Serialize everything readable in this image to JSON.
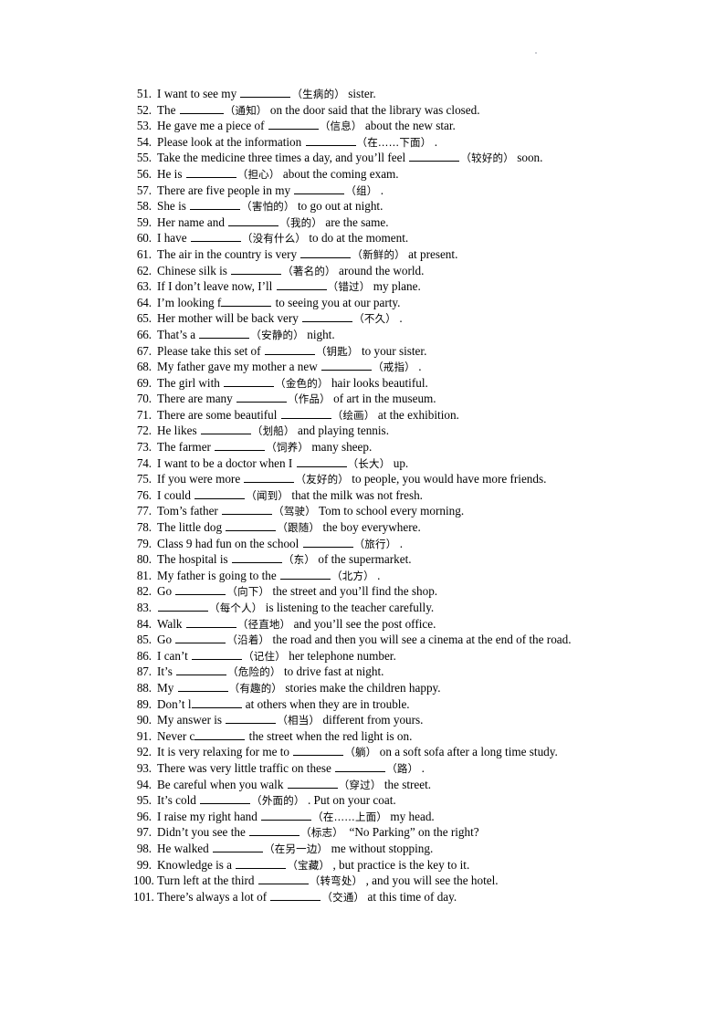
{
  "document": {
    "type": "worksheet",
    "title": "English vocabulary fill-in-the-blank exercises 51-101",
    "page_background": "#ffffff",
    "text_color": "#000000"
  },
  "exercises": [
    {
      "number": "51.",
      "segments": [
        {
          "kind": "text",
          "value": "I want to see my "
        },
        {
          "kind": "blank"
        },
        {
          "kind": "cn",
          "value": "（生病的）"
        },
        {
          "kind": "text",
          "value": " sister."
        }
      ]
    },
    {
      "number": "52.",
      "segments": [
        {
          "kind": "text",
          "value": "The "
        },
        {
          "kind": "blank",
          "width": "short"
        },
        {
          "kind": "cn",
          "value": "（通知）"
        },
        {
          "kind": "text",
          "value": " on the door said that the library was closed."
        }
      ]
    },
    {
      "number": "53.",
      "segments": [
        {
          "kind": "text",
          "value": "He gave me a piece of "
        },
        {
          "kind": "blank"
        },
        {
          "kind": "cn",
          "value": "（信息）"
        },
        {
          "kind": "text",
          "value": " about the new star."
        }
      ]
    },
    {
      "number": "54.",
      "segments": [
        {
          "kind": "text",
          "value": "Please look at the information "
        },
        {
          "kind": "blank"
        },
        {
          "kind": "cn",
          "value": "（在……下面）"
        },
        {
          "kind": "text",
          "value": " ."
        }
      ]
    },
    {
      "number": "55.",
      "segments": [
        {
          "kind": "text",
          "value": "Take the medicine three times a day, and you’ll feel "
        },
        {
          "kind": "blank"
        },
        {
          "kind": "cn",
          "value": "（较好的）"
        },
        {
          "kind": "text",
          "value": " soon."
        }
      ]
    },
    {
      "number": "56.",
      "segments": [
        {
          "kind": "text",
          "value": "He is "
        },
        {
          "kind": "blank"
        },
        {
          "kind": "cn",
          "value": "（担心）"
        },
        {
          "kind": "text",
          "value": " about the coming exam."
        }
      ]
    },
    {
      "number": "57.",
      "segments": [
        {
          "kind": "text",
          "value": "There are five people in my "
        },
        {
          "kind": "blank"
        },
        {
          "kind": "cn",
          "value": "（组）"
        },
        {
          "kind": "text",
          "value": " ."
        }
      ]
    },
    {
      "number": "58.",
      "segments": [
        {
          "kind": "text",
          "value": "She is "
        },
        {
          "kind": "blank"
        },
        {
          "kind": "cn",
          "value": "（害怕的）"
        },
        {
          "kind": "text",
          "value": " to go out at night."
        }
      ]
    },
    {
      "number": "59.",
      "segments": [
        {
          "kind": "text",
          "value": "Her name and "
        },
        {
          "kind": "blank"
        },
        {
          "kind": "cn",
          "value": "（我的）"
        },
        {
          "kind": "text",
          "value": " are the same."
        }
      ]
    },
    {
      "number": "60.",
      "segments": [
        {
          "kind": "text",
          "value": "I have "
        },
        {
          "kind": "blank"
        },
        {
          "kind": "cn",
          "value": "（没有什么）"
        },
        {
          "kind": "text",
          "value": " to do at the moment."
        }
      ]
    },
    {
      "number": "61.",
      "segments": [
        {
          "kind": "text",
          "value": "The air in the country is very "
        },
        {
          "kind": "blank"
        },
        {
          "kind": "cn",
          "value": "（新鲜的）"
        },
        {
          "kind": "text",
          "value": " at present."
        }
      ]
    },
    {
      "number": "62.",
      "segments": [
        {
          "kind": "text",
          "value": "Chinese silk is "
        },
        {
          "kind": "blank"
        },
        {
          "kind": "cn",
          "value": "（著名的）"
        },
        {
          "kind": "text",
          "value": " around the world."
        }
      ]
    },
    {
      "number": "63.",
      "segments": [
        {
          "kind": "text",
          "value": "If I don’t leave now, I’ll "
        },
        {
          "kind": "blank"
        },
        {
          "kind": "cn",
          "value": "（错过）"
        },
        {
          "kind": "text",
          "value": " my plane."
        }
      ]
    },
    {
      "number": "64.",
      "segments": [
        {
          "kind": "text",
          "value": "I’m looking f"
        },
        {
          "kind": "blank",
          "fused": true
        },
        {
          "kind": "text",
          "value": " to seeing you at our party."
        }
      ]
    },
    {
      "number": "65.",
      "segments": [
        {
          "kind": "text",
          "value": "Her mother will be back very "
        },
        {
          "kind": "blank"
        },
        {
          "kind": "cn",
          "value": "（不久）"
        },
        {
          "kind": "text",
          "value": " ."
        }
      ]
    },
    {
      "number": "66.",
      "segments": [
        {
          "kind": "text",
          "value": "That’s a "
        },
        {
          "kind": "blank"
        },
        {
          "kind": "cn",
          "value": "（安静的）"
        },
        {
          "kind": "text",
          "value": " night."
        }
      ]
    },
    {
      "number": "67.",
      "segments": [
        {
          "kind": "text",
          "value": "Please take this set of "
        },
        {
          "kind": "blank"
        },
        {
          "kind": "cn",
          "value": "（钥匙）"
        },
        {
          "kind": "text",
          "value": " to your sister."
        }
      ]
    },
    {
      "number": "68.",
      "segments": [
        {
          "kind": "text",
          "value": "My father gave my mother a new "
        },
        {
          "kind": "blank"
        },
        {
          "kind": "cn",
          "value": "（戒指）"
        },
        {
          "kind": "text",
          "value": " ."
        }
      ]
    },
    {
      "number": "69.",
      "segments": [
        {
          "kind": "text",
          "value": "The girl with "
        },
        {
          "kind": "blank"
        },
        {
          "kind": "cn",
          "value": "（金色的）"
        },
        {
          "kind": "text",
          "value": " hair looks beautiful."
        }
      ]
    },
    {
      "number": "70.",
      "segments": [
        {
          "kind": "text",
          "value": "There are many "
        },
        {
          "kind": "blank"
        },
        {
          "kind": "cn",
          "value": "（作品）"
        },
        {
          "kind": "text",
          "value": " of art in the museum."
        }
      ]
    },
    {
      "number": "71.",
      "segments": [
        {
          "kind": "text",
          "value": "There are some beautiful "
        },
        {
          "kind": "blank"
        },
        {
          "kind": "cn",
          "value": "（绘画）"
        },
        {
          "kind": "text",
          "value": " at the exhibition."
        }
      ]
    },
    {
      "number": "72.",
      "segments": [
        {
          "kind": "text",
          "value": "He likes "
        },
        {
          "kind": "blank"
        },
        {
          "kind": "cn",
          "value": "（划船）"
        },
        {
          "kind": "text",
          "value": " and playing tennis."
        }
      ]
    },
    {
      "number": "73.",
      "segments": [
        {
          "kind": "text",
          "value": "The farmer "
        },
        {
          "kind": "blank"
        },
        {
          "kind": "cn",
          "value": "（饲养）"
        },
        {
          "kind": "text",
          "value": " many sheep."
        }
      ]
    },
    {
      "number": "74.",
      "segments": [
        {
          "kind": "text",
          "value": "I want to be a doctor when I "
        },
        {
          "kind": "blank"
        },
        {
          "kind": "cn",
          "value": "（长大）"
        },
        {
          "kind": "text",
          "value": " up."
        }
      ]
    },
    {
      "number": "75.",
      "segments": [
        {
          "kind": "text",
          "value": "If you were more "
        },
        {
          "kind": "blank"
        },
        {
          "kind": "cn",
          "value": "（友好的）"
        },
        {
          "kind": "text",
          "value": " to people, you would have more friends."
        }
      ]
    },
    {
      "number": "76.",
      "segments": [
        {
          "kind": "text",
          "value": "I could "
        },
        {
          "kind": "blank"
        },
        {
          "kind": "cn",
          "value": "（闻到）"
        },
        {
          "kind": "text",
          "value": " that the milk was not fresh."
        }
      ]
    },
    {
      "number": "77.",
      "segments": [
        {
          "kind": "text",
          "value": "Tom’s father "
        },
        {
          "kind": "blank"
        },
        {
          "kind": "cn",
          "value": "（驾驶）"
        },
        {
          "kind": "text",
          "value": " Tom to school every morning."
        }
      ]
    },
    {
      "number": "78.",
      "segments": [
        {
          "kind": "text",
          "value": "The little dog "
        },
        {
          "kind": "blank"
        },
        {
          "kind": "cn",
          "value": "（跟随）"
        },
        {
          "kind": "text",
          "value": " the boy everywhere."
        }
      ]
    },
    {
      "number": "79.",
      "segments": [
        {
          "kind": "text",
          "value": "Class 9 had fun on the school "
        },
        {
          "kind": "blank"
        },
        {
          "kind": "cn",
          "value": "（旅行）"
        },
        {
          "kind": "text",
          "value": " ."
        }
      ]
    },
    {
      "number": "80.",
      "segments": [
        {
          "kind": "text",
          "value": "The hospital is "
        },
        {
          "kind": "blank"
        },
        {
          "kind": "cn",
          "value": "（东）"
        },
        {
          "kind": "text",
          "value": " of the supermarket."
        }
      ]
    },
    {
      "number": "81.",
      "segments": [
        {
          "kind": "text",
          "value": "My father is going to the "
        },
        {
          "kind": "blank"
        },
        {
          "kind": "cn",
          "value": "（北方）"
        },
        {
          "kind": "text",
          "value": " ."
        }
      ]
    },
    {
      "number": "82.",
      "segments": [
        {
          "kind": "text",
          "value": "Go "
        },
        {
          "kind": "blank"
        },
        {
          "kind": "cn",
          "value": "（向下）"
        },
        {
          "kind": "text",
          "value": " the street and you’ll find the shop."
        }
      ]
    },
    {
      "number": "83.",
      "segments": [
        {
          "kind": "blank"
        },
        {
          "kind": "cn",
          "value": "（每个人）"
        },
        {
          "kind": "text",
          "value": " is listening to the teacher carefully."
        }
      ]
    },
    {
      "number": "84.",
      "segments": [
        {
          "kind": "text",
          "value": "Walk "
        },
        {
          "kind": "blank"
        },
        {
          "kind": "cn",
          "value": "（径直地）"
        },
        {
          "kind": "text",
          "value": " and you’ll see the post office."
        }
      ]
    },
    {
      "number": "85.",
      "segments": [
        {
          "kind": "text",
          "value": "Go "
        },
        {
          "kind": "blank"
        },
        {
          "kind": "cn",
          "value": "（沿着）"
        },
        {
          "kind": "text",
          "value": " the road and then you will see a cinema at the end of the road."
        }
      ]
    },
    {
      "number": "86.",
      "segments": [
        {
          "kind": "text",
          "value": "I can’t "
        },
        {
          "kind": "blank"
        },
        {
          "kind": "cn",
          "value": "（记住）"
        },
        {
          "kind": "text",
          "value": " her telephone number."
        }
      ]
    },
    {
      "number": "87.",
      "segments": [
        {
          "kind": "text",
          "value": "It’s "
        },
        {
          "kind": "blank"
        },
        {
          "kind": "cn",
          "value": "（危险的）"
        },
        {
          "kind": "text",
          "value": " to drive fast at night."
        }
      ]
    },
    {
      "number": "88.",
      "segments": [
        {
          "kind": "text",
          "value": "My "
        },
        {
          "kind": "blank"
        },
        {
          "kind": "cn",
          "value": "（有趣的）"
        },
        {
          "kind": "text",
          "value": " stories make the children happy."
        }
      ]
    },
    {
      "number": "89.",
      "segments": [
        {
          "kind": "text",
          "value": "Don’t l"
        },
        {
          "kind": "blank",
          "fused": true
        },
        {
          "kind": "text",
          "value": " at others when they are in trouble."
        }
      ]
    },
    {
      "number": "90.",
      "segments": [
        {
          "kind": "text",
          "value": "My answer is "
        },
        {
          "kind": "blank"
        },
        {
          "kind": "cn",
          "value": "（相当）"
        },
        {
          "kind": "text",
          "value": " different from yours."
        }
      ]
    },
    {
      "number": "91.",
      "segments": [
        {
          "kind": "text",
          "value": "Never c"
        },
        {
          "kind": "blank",
          "fused": true
        },
        {
          "kind": "text",
          "value": " the street when the red light is on."
        }
      ]
    },
    {
      "number": "92.",
      "segments": [
        {
          "kind": "text",
          "value": "It is very relaxing for me to "
        },
        {
          "kind": "blank"
        },
        {
          "kind": "cn",
          "value": "（躺）"
        },
        {
          "kind": "text",
          "value": " on a soft sofa after a long time study."
        }
      ]
    },
    {
      "number": "93.",
      "segments": [
        {
          "kind": "text",
          "value": "There was very little traffic on these "
        },
        {
          "kind": "blank"
        },
        {
          "kind": "cn",
          "value": "（路）"
        },
        {
          "kind": "text",
          "value": " ."
        }
      ]
    },
    {
      "number": "94.",
      "segments": [
        {
          "kind": "text",
          "value": "Be careful when you walk "
        },
        {
          "kind": "blank"
        },
        {
          "kind": "cn",
          "value": "（穿过）"
        },
        {
          "kind": "text",
          "value": " the street."
        }
      ]
    },
    {
      "number": "95.",
      "segments": [
        {
          "kind": "text",
          "value": "It’s cold "
        },
        {
          "kind": "blank"
        },
        {
          "kind": "cn",
          "value": "（外面的）"
        },
        {
          "kind": "text",
          "value": " . Put on your coat."
        }
      ]
    },
    {
      "number": "96.",
      "segments": [
        {
          "kind": "text",
          "value": "I raise my right hand "
        },
        {
          "kind": "blank"
        },
        {
          "kind": "cn",
          "value": "（在……上面）"
        },
        {
          "kind": "text",
          "value": " my head."
        }
      ]
    },
    {
      "number": "97.",
      "segments": [
        {
          "kind": "text",
          "value": "Didn’t you see the "
        },
        {
          "kind": "blank"
        },
        {
          "kind": "cn",
          "value": "（标志）"
        },
        {
          "kind": "text",
          "value": "  “No Parking” on the right?"
        }
      ]
    },
    {
      "number": "98.",
      "segments": [
        {
          "kind": "text",
          "value": "He walked "
        },
        {
          "kind": "blank"
        },
        {
          "kind": "cn",
          "value": "（在另一边）"
        },
        {
          "kind": "text",
          "value": " me without stopping."
        }
      ]
    },
    {
      "number": "99.",
      "segments": [
        {
          "kind": "text",
          "value": "Knowledge is a "
        },
        {
          "kind": "blank"
        },
        {
          "kind": "cn",
          "value": "（宝藏）"
        },
        {
          "kind": "text",
          "value": " , but practice is the key to it."
        }
      ]
    },
    {
      "number": "100.",
      "segments": [
        {
          "kind": "text",
          "value": "Turn left at the third "
        },
        {
          "kind": "blank"
        },
        {
          "kind": "cn",
          "value": "（转弯处）"
        },
        {
          "kind": "text",
          "value": " , and you will see the hotel."
        }
      ]
    },
    {
      "number": "101.",
      "segments": [
        {
          "kind": "text",
          "value": "There’s always a lot of "
        },
        {
          "kind": "blank"
        },
        {
          "kind": "cn",
          "value": "（交通）"
        },
        {
          "kind": "text",
          "value": " at this time of day."
        }
      ]
    }
  ]
}
